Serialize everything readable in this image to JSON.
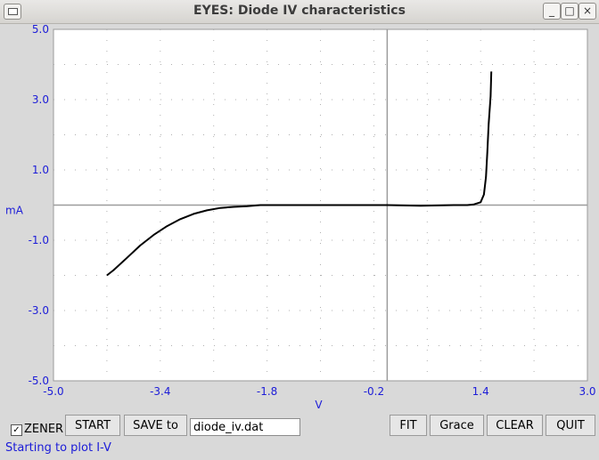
{
  "window": {
    "title": "EYES: Diode IV characteristics",
    "controls": [
      "_",
      "□",
      "×"
    ]
  },
  "chart_data": {
    "type": "line",
    "title": "",
    "xlabel": "V",
    "ylabel": "mA",
    "xlim": [
      -5.0,
      3.0
    ],
    "ylim": [
      -5.0,
      5.0
    ],
    "x_ticks": [
      "-5.0",
      "-3.4",
      "-1.8",
      "-0.2",
      "1.4",
      "3.0"
    ],
    "y_ticks": [
      "5.0",
      "3.0",
      "1.0",
      "-1.0",
      "-3.0",
      "-5.0"
    ],
    "grid": true,
    "series": [
      {
        "x": [
          -4.2,
          -4.1,
          -3.9,
          -3.7,
          -3.5,
          -3.3,
          -3.1,
          -2.9,
          -2.7,
          -2.5,
          -2.3,
          -2.1,
          -1.9,
          -1.7,
          -1.5,
          -1.0,
          -0.5,
          0.0,
          0.5,
          1.0,
          1.2,
          1.3,
          1.4,
          1.45,
          1.48,
          1.5,
          1.52,
          1.55,
          1.56
        ],
        "y": [
          -2.0,
          -1.85,
          -1.5,
          -1.15,
          -0.85,
          -0.6,
          -0.4,
          -0.25,
          -0.15,
          -0.08,
          -0.05,
          -0.03,
          0.0,
          0.0,
          0.0,
          0.0,
          0.0,
          0.0,
          -0.02,
          0.0,
          0.0,
          0.02,
          0.08,
          0.3,
          0.8,
          1.5,
          2.3,
          3.1,
          3.8
        ]
      }
    ]
  },
  "controls": {
    "zener_checked": true,
    "zener_label": "ZENER",
    "start_label": "START",
    "save_label": "SAVE to",
    "filename": "diode_iv.dat",
    "fit_label": "FIT",
    "grace_label": "Grace",
    "clear_label": "CLEAR",
    "quit_label": "QUIT",
    "check_glyph": "✓"
  },
  "status": "Starting to plot I-V",
  "colors": {
    "axis_text": "#1c1cd8",
    "curve": "#000000",
    "plot_bg": "#ffffff"
  }
}
